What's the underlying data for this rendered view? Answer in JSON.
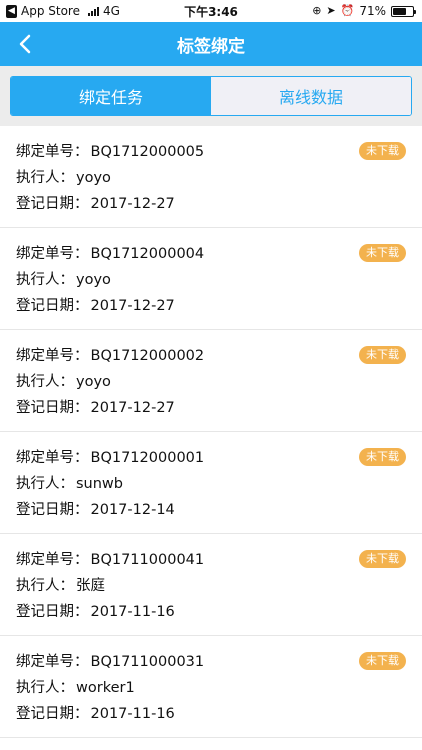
{
  "status_bar": {
    "back_app": "App Store",
    "network": "4G",
    "time": "下午3:46",
    "battery": "71%",
    "battery_level": 0.71
  },
  "nav": {
    "title": "标签绑定",
    "back_icon": "chevron-left-icon"
  },
  "tabs": [
    {
      "label": "绑定任务",
      "active": true
    },
    {
      "label": "离线数据",
      "active": false
    }
  ],
  "labels": {
    "order_no": "绑定单号：",
    "executor": "执行人：",
    "date": "登记日期："
  },
  "colors": {
    "accent": "#27a9f1",
    "badge": "#f3b24e"
  },
  "tasks": [
    {
      "order_no": "BQ1712000005",
      "executor": "yoyo",
      "date": "2017-12-27",
      "status": "未下载"
    },
    {
      "order_no": "BQ1712000004",
      "executor": "yoyo",
      "date": "2017-12-27",
      "status": "未下载"
    },
    {
      "order_no": "BQ1712000002",
      "executor": "yoyo",
      "date": "2017-12-27",
      "status": "未下载"
    },
    {
      "order_no": "BQ1712000001",
      "executor": "sunwb",
      "date": "2017-12-14",
      "status": "未下载"
    },
    {
      "order_no": "BQ1711000041",
      "executor": "张庭",
      "date": "2017-11-16",
      "status": "未下载"
    },
    {
      "order_no": "BQ1711000031",
      "executor": "worker1",
      "date": "2017-11-16",
      "status": "未下载"
    }
  ]
}
